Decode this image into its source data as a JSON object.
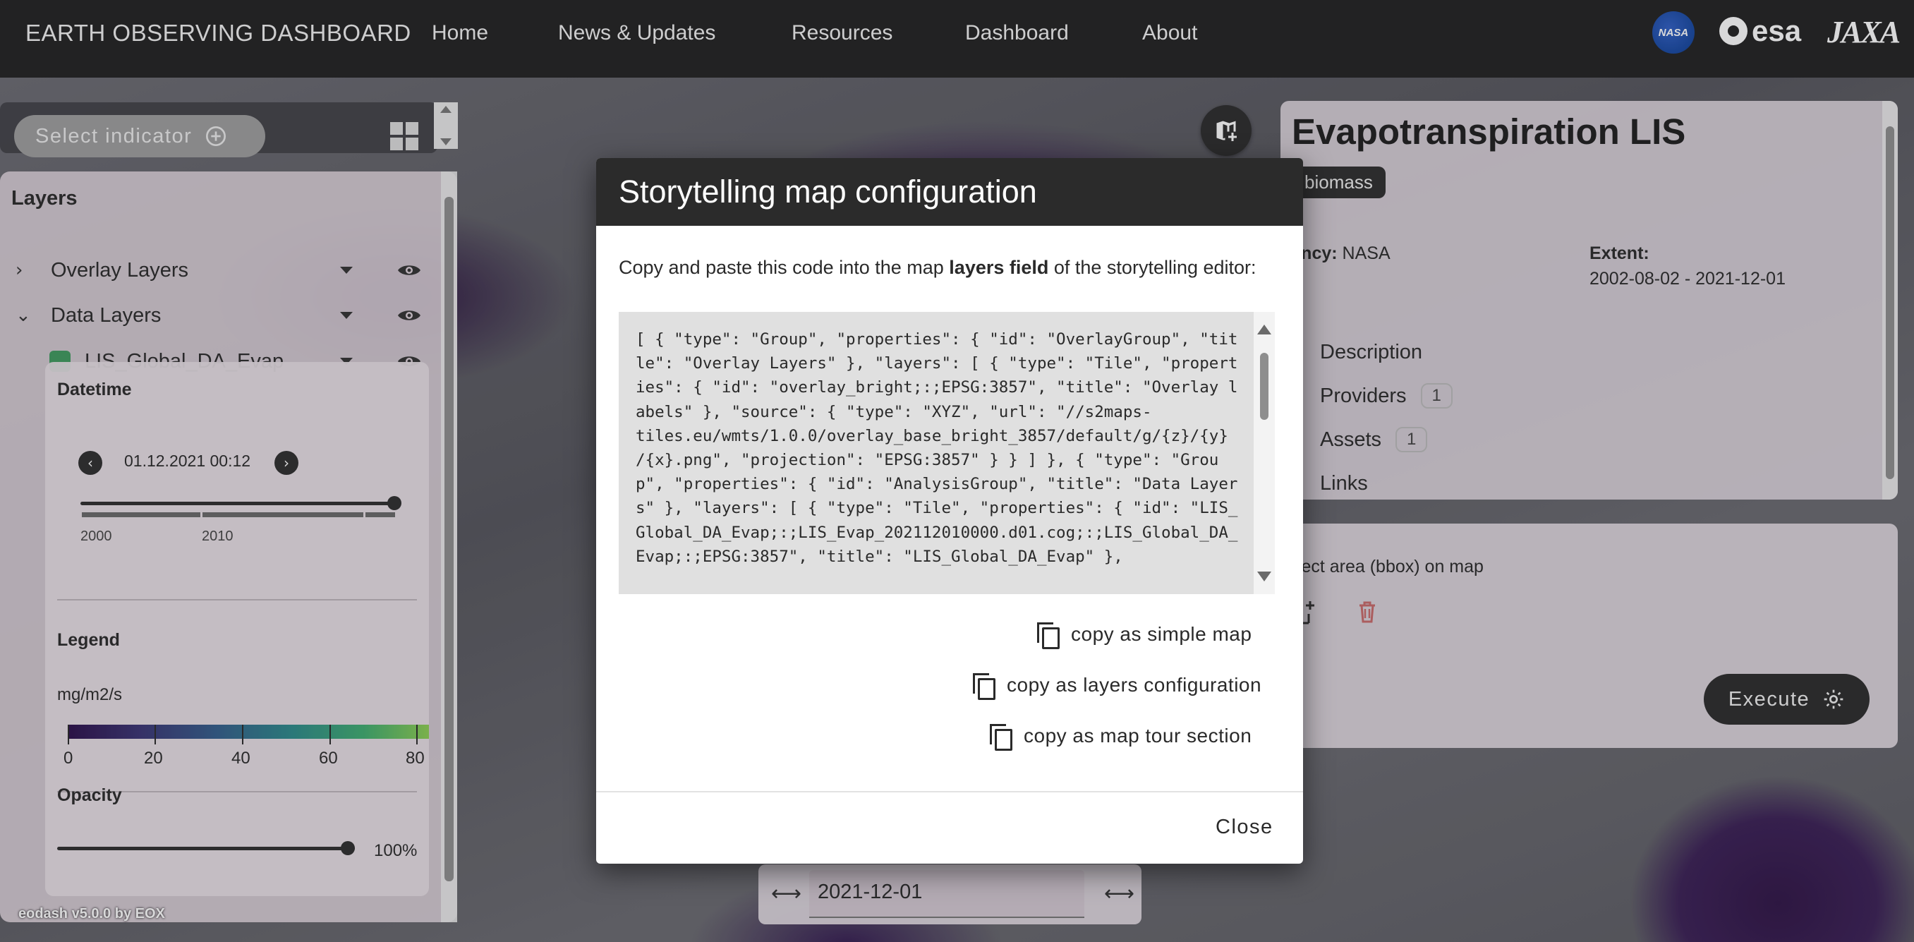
{
  "header": {
    "brand": "EARTH OBSERVING DASHBOARD",
    "nav": [
      "Home",
      "News & Updates",
      "Resources",
      "Dashboard",
      "About"
    ],
    "logos": {
      "nasa": "NASA",
      "esa": "esa",
      "jaxa": "JAXA"
    }
  },
  "left_panel": {
    "select_indicator": "Select indicator",
    "layers_title": "Layers",
    "layers": [
      {
        "label": "Overlay Layers",
        "expanded": false
      },
      {
        "label": "Data Layers",
        "expanded": true
      },
      {
        "label": "LIS_Global_DA_Evap",
        "color": "#3f9a5e"
      }
    ],
    "datetime": {
      "title": "Datetime",
      "value": "01.12.2021 00:12",
      "timeline_labels": [
        "2000",
        "2010"
      ]
    },
    "legend": {
      "title": "Legend",
      "unit": "mg/m2/s",
      "ticks": [
        "0",
        "20",
        "40",
        "60",
        "80"
      ]
    },
    "opacity": {
      "title": "Opacity",
      "value": "100%",
      "level": 1.0
    },
    "footer": "eodash v5.0.0 by EOX"
  },
  "info_panel": {
    "title": "Evapotranspiration LIS",
    "tag": "biomass",
    "agency_label": "Agency:",
    "agency_label_visible": "gency:",
    "agency_value": "NASA",
    "extent_label": "Extent:",
    "extent_value": "2002-08-02 - 2021-12-01",
    "sections": [
      {
        "label": "Description"
      },
      {
        "label": "Providers",
        "count": "1"
      },
      {
        "label": "Assets",
        "count": "1"
      },
      {
        "label": "Links"
      }
    ]
  },
  "bbox_panel": {
    "label": "Select area (bbox) on map",
    "label_visible": "elect area (bbox) on map",
    "execute": "Execute"
  },
  "date_bar": {
    "value": "2021-12-01"
  },
  "modal": {
    "title": "Storytelling map configuration",
    "intro_pre": "Copy and paste this code into the map ",
    "intro_bold": "layers field",
    "intro_post": " of the storytelling editor:",
    "code": "[ { \"type\": \"Group\", \"properties\": { \"id\": \"OverlayGroup\", \"title\": \"Overlay Layers\" }, \"layers\": [ { \"type\": \"Tile\", \"properties\": { \"id\": \"overlay_bright;:;EPSG:3857\", \"title\": \"Overlay labels\" }, \"source\": { \"type\": \"XYZ\", \"url\": \"//s2maps-\ntiles.eu/wmts/1.0.0/overlay_base_bright_3857/default/g/{z}/{y}\n/{x}.png\", \"projection\": \"EPSG:3857\" } } ] }, { \"type\": \"Group\", \"properties\": { \"id\": \"AnalysisGroup\", \"title\": \"Data Layers\" }, \"layers\": [ { \"type\": \"Tile\", \"properties\": { \"id\": \"LIS_Global_DA_Evap;:;LIS_Evap_202112010000.d01.cog;:;LIS_Global_DA_Evap;:;EPSG:3857\", \"title\": \"LIS_Global_DA_Evap\" },",
    "buttons": [
      "copy as simple map",
      "copy as layers configuration",
      "copy as map tour section"
    ],
    "close": "Close"
  }
}
